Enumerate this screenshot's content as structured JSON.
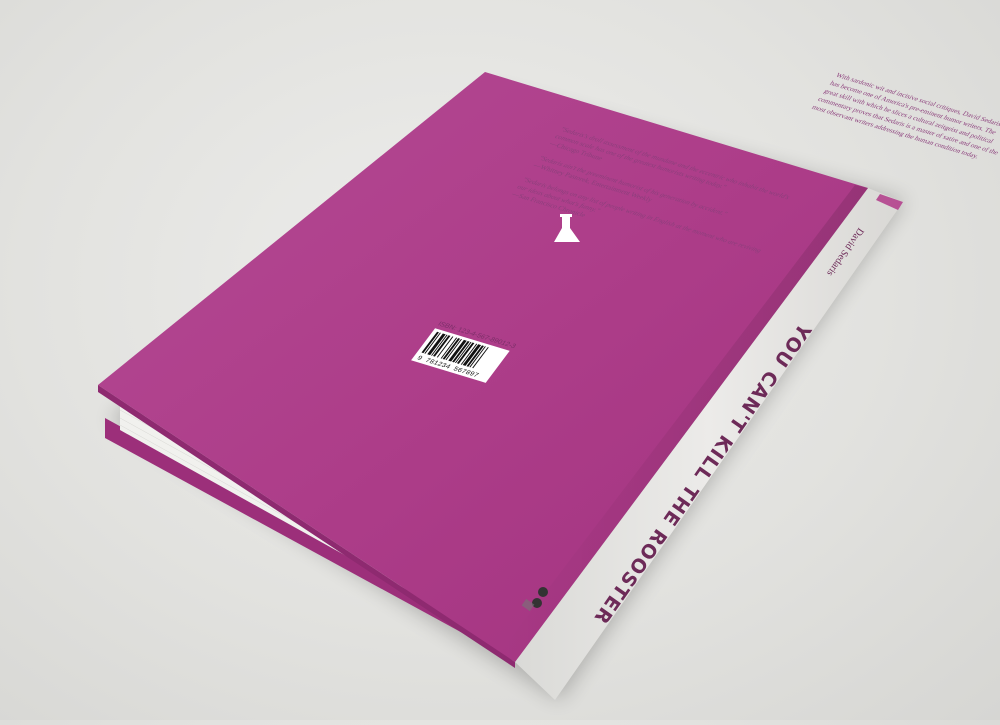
{
  "book": {
    "title": "YOU CAN'T KILL THE ROOSTER",
    "author": "David Sedaris",
    "colors": {
      "cover": "#b4418f",
      "spine": "#e6e5e3",
      "pages": "#f2f2ef",
      "accent": "#6d2a58"
    }
  },
  "back_cover": {
    "intro": [
      "With sardonic wit and incisive social critiques, David Sedaris",
      "has become one of America's pre-eminent humor writers. The",
      "great skill with which he slices a cultural zeitgeist and political",
      "commentary proves that Sedaris is a master of satire and one of the",
      "most observant writers addressing the human condition today."
    ],
    "quotes": [
      {
        "text": [
          "\"Sedaris's droll assessment of the mundane and the eccentric who inhabit the world's",
          "common scale has one of the greatest humorists writing today.\""
        ],
        "source": "—Chicago Tribune"
      },
      {
        "text": [
          "\"Sedaris ain't the preeminent humorist of his generation by accident.\""
        ],
        "source": "—Whitney Pastorek, Entertainment Weekly"
      },
      {
        "text": [
          "\"Sedaris belongs on any list of people writing in English at the moment who are reviving",
          "our ideas about what's funny.\""
        ],
        "source": "—San Francisco Chronicle"
      }
    ],
    "isbn": "ISBN: 123-4-567-89012-3",
    "barcode_digits": "9 781234 567897"
  },
  "spine": {
    "title": "YOU CAN'T KILL THE ROOSTER",
    "author": "David Sedaris"
  }
}
